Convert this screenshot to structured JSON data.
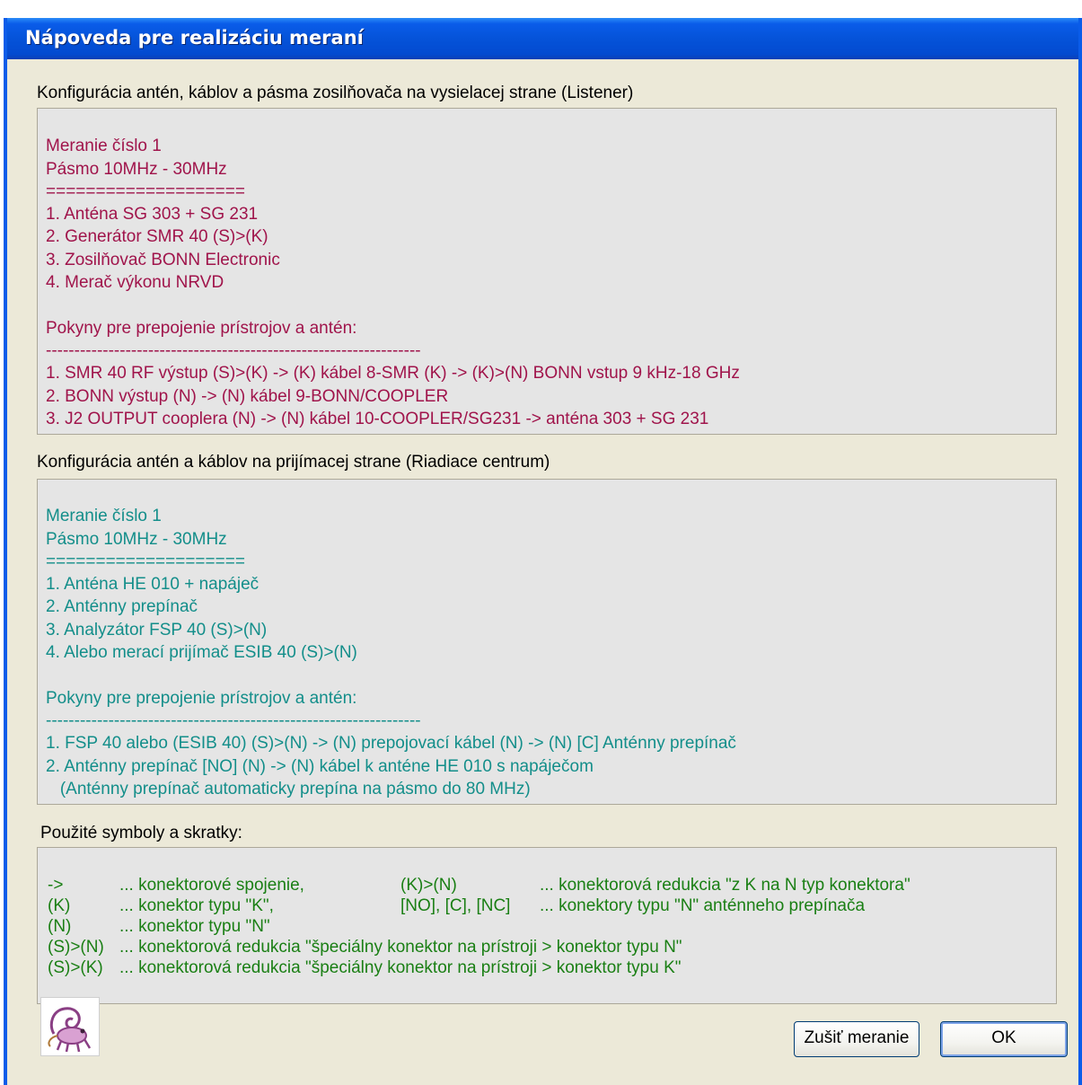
{
  "window": {
    "title": "Nápoveda pre realizáciu meraní"
  },
  "listener_section": {
    "label": "Konfigurácia antén, káblov a pásma zosilňovača na vysielacej strane (Listener)",
    "lines": [
      "",
      "Meranie číslo 1",
      "Pásmo 10MHz - 30MHz",
      "====================",
      "1. Anténa SG 303 + SG 231",
      "2. Generátor SMR 40 (S)>(K)",
      "3. Zosilňovač BONN Electronic",
      "4. Merač výkonu NRVD",
      "",
      "Pokyny pre prepojenie prístrojov a antén:",
      "------------------------------------------------------------------",
      "1. SMR 40 RF výstup (S)>(K) -> (K) kábel 8-SMR (K) -> (K)>(N) BONN vstup 9 kHz-18 GHz",
      "2. BONN výstup (N) -> (N) kábel 9-BONN/COOPLER",
      "3. J2 OUTPUT cooplera (N) -> (N) kábel 10-COOPLER/SG231 -> anténa 303 + SG 231"
    ]
  },
  "receiver_section": {
    "label": "Konfigurácia antén a káblov na prijímacej strane (Riadiace centrum)",
    "lines": [
      "",
      "Meranie číslo 1",
      "Pásmo 10MHz - 30MHz",
      "====================",
      "1. Anténa HE 010 + napáječ",
      "2. Anténny prepínač",
      "3. Analyzátor FSP 40 (S)>(N)",
      "4. Alebo merací prijímač ESIB 40 (S)>(N)",
      "",
      "Pokyny pre prepojenie prístrojov a antén:",
      "------------------------------------------------------------------",
      "1. FSP 40 alebo (ESIB 40) (S)>(N) -> (N) prepojovací kábel (N) -> (N) [C] Anténny prepínač",
      "2. Anténny prepínač [NO] (N) -> (N) kábel k anténe HE 010 s napáječom",
      "   (Anténny prepínač automaticky prepína na pásmo do 80 MHz)"
    ]
  },
  "symbols_section": {
    "label": "Použité symboly a skratky:",
    "rows": [
      {
        "sym": "->",
        "desc": "... konektorové spojenie,",
        "sym2": "(K)>(N)",
        "desc2": "... konektorová redukcia \"z K na N typ konektora\""
      },
      {
        "sym": "(K)",
        "desc": "... konektor typu \"K\",",
        "sym2": "[NO], [C], [NC]",
        "desc2": "... konektory typu \"N\" anténneho prepínača"
      },
      {
        "sym": "(N)",
        "desc": "... konektor typu \"N\"",
        "sym2": "",
        "desc2": ""
      },
      {
        "sym": "(S)>(N)",
        "desc": "... konektorová redukcia \"špeciálny konektor na prístroji > konektor typu N\"",
        "sym2": "",
        "desc2": ""
      },
      {
        "sym": "(S)>(K)",
        "desc": "... konektorová redukcia \"špeciálny konektor na prístroji > konektor typu K\"",
        "sym2": "",
        "desc2": ""
      }
    ]
  },
  "buttons": {
    "cancel_label": "Zušiť meranie",
    "ok_label": "OK"
  },
  "icons": {
    "logo": "chameleon-logo-icon"
  },
  "colors": {
    "titlebar": "#0a5ce9",
    "dialog_bg": "#ece9d8",
    "panel_bg": "#e5e5e5",
    "listener_text": "#a0144b",
    "receiver_text": "#138e8a",
    "symbols_text": "#1a7f14"
  }
}
